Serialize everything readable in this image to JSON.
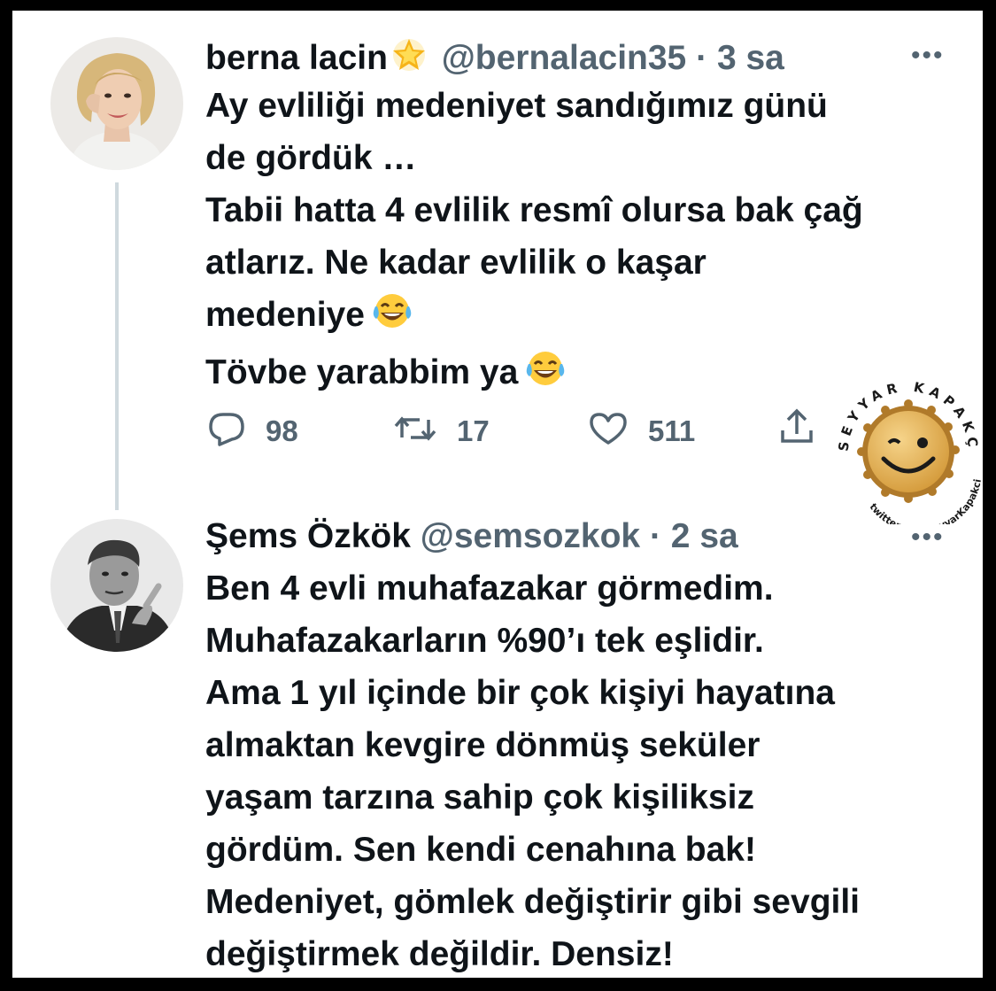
{
  "tweets": [
    {
      "name": "berna lacin",
      "handle": "@bernalacin35",
      "separator": "·",
      "time": "3 sa",
      "lines": [
        "Ay evliliği medeniyet sandığımız günü",
        "de gördük …",
        "Tabii hatta 4 evlilik resmî olursa bak çağ",
        "atlarız. Ne kadar evlilik o kaşar",
        "medeniye",
        "Tövbe yarabbim ya"
      ],
      "stats": {
        "replies": "98",
        "retweets": "17",
        "likes": "511"
      }
    },
    {
      "name": "Şems Özkök",
      "handle": "@semsozkok",
      "separator": "·",
      "time": "2 sa",
      "lines": [
        "Ben 4 evli muhafazakar görmedim.",
        "Muhafazakarların %90’ı tek eşlidir.",
        "Ama 1 yıl içinde bir çok kişiyi hayatına",
        "almaktan kevgire dönmüş seküler",
        "yaşam tarzına sahip çok kişiliksiz",
        "gördüm. Sen kendi cenahına bak!",
        "Medeniyet, gömlek değiştirir gibi sevgili",
        "değiştirmek değildir. Densiz!"
      ]
    }
  ],
  "more_label": "•••",
  "watermark": {
    "top_text": "SEYYAR KAPAKÇI",
    "bottom_text": "twitter.com/SeyyarKapakci"
  },
  "icons": {
    "reply": "reply-icon",
    "retweet": "retweet-icon",
    "like": "like-icon",
    "share": "share-icon",
    "star": "glowing-star-icon",
    "laugh": "tears-of-joy-emoji"
  },
  "colors": {
    "text": "#0f1419",
    "muted": "#536471",
    "thread": "#cfd9de"
  }
}
